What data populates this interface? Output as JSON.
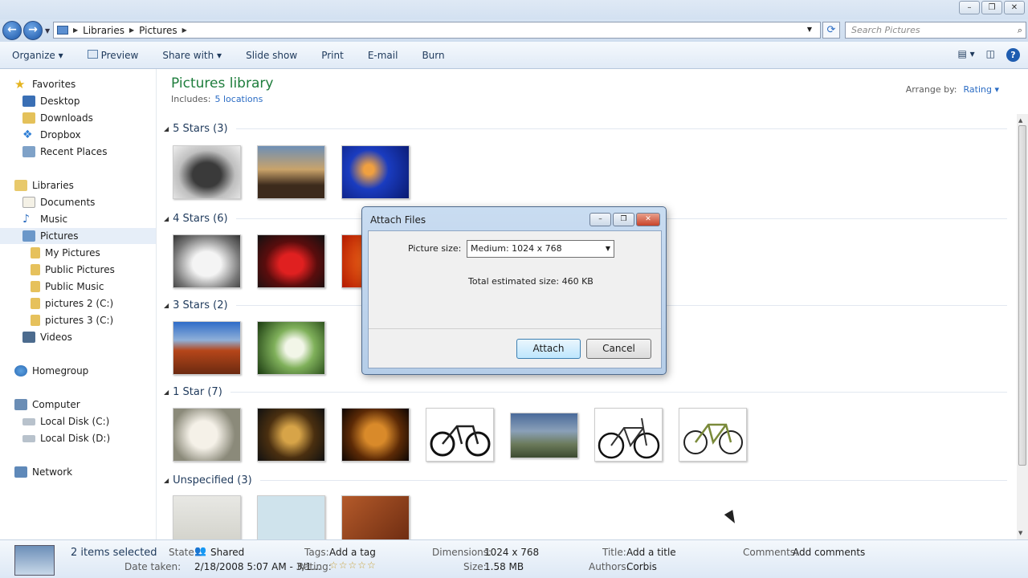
{
  "window": {
    "minimize": "–",
    "maximize": "❐",
    "close": "✕"
  },
  "address": {
    "crumbs": [
      "Libraries",
      "Pictures"
    ],
    "search_placeholder": "Search Pictures"
  },
  "toolbar": {
    "items": [
      "Organize ▾",
      "Preview",
      "Share with ▾",
      "Slide show",
      "Print",
      "E-mail",
      "Burn"
    ]
  },
  "nav": {
    "favorites": "Favorites",
    "desktop": "Desktop",
    "downloads": "Downloads",
    "dropbox": "Dropbox",
    "recent": "Recent Places",
    "libraries": "Libraries",
    "documents": "Documents",
    "music": "Music",
    "pictures": "Pictures",
    "my_pictures": "My Pictures",
    "public_pictures": "Public Pictures",
    "public_music": "Public Music",
    "pictures2": "pictures 2 (C:)",
    "pictures3": "pictures 3 (C:)",
    "videos": "Videos",
    "homegroup": "Homegroup",
    "computer": "Computer",
    "local_c": "Local Disk (C:)",
    "local_d": "Local Disk (D:)",
    "network": "Network"
  },
  "library": {
    "title": "Pictures library",
    "includes_label": "Includes:",
    "includes_link": "5 locations",
    "arrange_label": "Arrange by:",
    "arrange_value": "Rating ▾"
  },
  "groups": [
    "5 Stars (3)",
    "4 Stars (6)",
    "3 Stars (2)",
    "1 Star (7)",
    "Unspecified (3)"
  ],
  "dialog": {
    "title": "Attach Files",
    "picture_size_label": "Picture size:",
    "picture_size_value": "Medium: 1024 x 768",
    "estimate": "Total estimated size:  460 KB",
    "attach": "Attach",
    "cancel": "Cancel"
  },
  "details": {
    "selected": "2 items selected",
    "state_label": "State:",
    "state_value": "Shared",
    "date_label": "Date taken:",
    "date_value": "2/18/2008 5:07 AM - 3/1...",
    "tags_label": "Tags:",
    "tags_value": "Add a tag",
    "rating_label": "Rating:",
    "rating_value": "☆☆☆☆☆",
    "dim_label": "Dimensions:",
    "dim_value": "1024 x 768",
    "size_label": "Size:",
    "size_value": "1.58 MB",
    "title_label": "Title:",
    "title_value": "Add a title",
    "authors_label": "Authors:",
    "authors_value": "Corbis",
    "comments_label": "Comments:",
    "comments_value": "Add comments"
  }
}
